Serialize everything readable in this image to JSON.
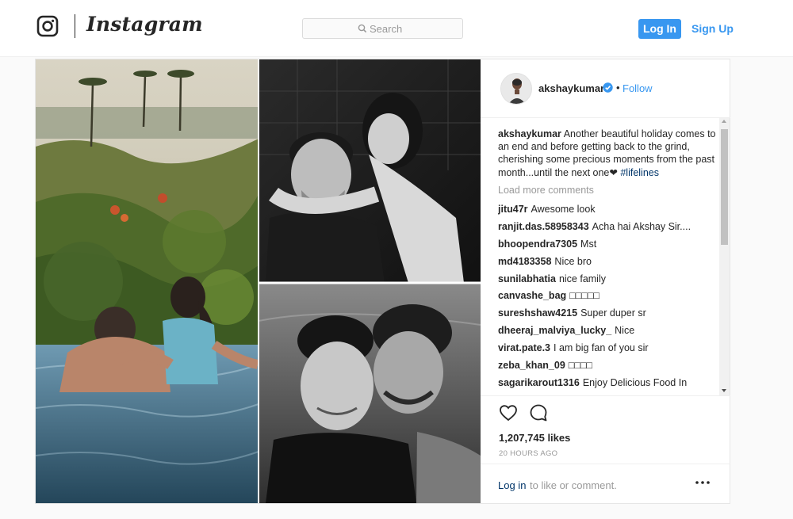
{
  "header": {
    "brand": "Instagram",
    "search_placeholder": "Search",
    "login_label": "Log In",
    "signup_label": "Sign Up"
  },
  "post": {
    "username": "akshaykumar",
    "verified": true,
    "bullet": "•",
    "follow_label": "Follow",
    "caption": {
      "user": "akshaykumar",
      "text": "Another beautiful holiday comes to an end and before getting back to the grind, cherishing some precious moments from the past month...until the next one",
      "heart": "❤",
      "hashtag": "#lifelines"
    },
    "load_more_label": "Load more comments",
    "comments": [
      {
        "user": "jitu47r",
        "text": "Awesome look"
      },
      {
        "user": "ranjit.das.58958343",
        "text": "Acha hai Akshay Sir...."
      },
      {
        "user": "bhoopendra7305",
        "text": "Mst"
      },
      {
        "user": "md4183358",
        "text": "Nice bro"
      },
      {
        "user": "sunilabhatia",
        "text": "nice family"
      },
      {
        "user": "canvashe_bag",
        "text": "□□□□□"
      },
      {
        "user": "sureshshaw4215",
        "text": "Super duper sr"
      },
      {
        "user": "dheeraj_malviya_lucky_",
        "text": "Nice"
      },
      {
        "user": "virat.pate.3",
        "text": "I am big fan of you sir"
      },
      {
        "user": "zeba_khan_09",
        "text": "□□□□"
      },
      {
        "user": "sagarikarout1316",
        "text": "Enjoy Delicious Food In"
      }
    ],
    "likes": "1,207,745 likes",
    "time": "20 HOURS AGO",
    "footer": {
      "login_label": "Log in",
      "rest": "to like or comment."
    },
    "icons": {
      "like": "heart-outline-icon",
      "comment": "speech-bubble-icon",
      "options": "ellipsis-icon",
      "verified": "verified-badge-icon"
    }
  },
  "colors": {
    "accent": "#3897f0",
    "text": "#262626",
    "muted": "#999999",
    "link_dark": "#003569",
    "page_bg": "#fafafa"
  }
}
